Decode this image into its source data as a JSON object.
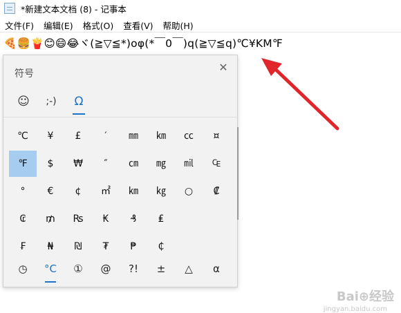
{
  "window": {
    "title": "*新建文本文档 (8) - 记事本"
  },
  "menu": [
    "文件(F)",
    "编辑(E)",
    "格式(O)",
    "查看(V)",
    "帮助(H)"
  ],
  "editor": {
    "text": "🍕🍔🍟😊😄😂ヾ(≧▽≦*)oφ(*￣0￣)q(≧▽≦q)℃¥KM℉"
  },
  "panel": {
    "title": "符号",
    "close": "✕",
    "categories": [
      {
        "icon": "☺",
        "name": "emoji"
      },
      {
        "icon": ";-)",
        "name": "kaomoji"
      },
      {
        "icon": "Ω",
        "name": "symbols",
        "active": true
      }
    ],
    "symbols": [
      [
        "℃",
        "¥",
        "£",
        "′",
        "㎜",
        "㎞",
        "㏄",
        "¤"
      ],
      [
        "℉",
        "$",
        "₩",
        "″",
        "㎝",
        "㎎",
        "㏕",
        "₠"
      ],
      [
        "°",
        "€",
        "¢",
        "㎡",
        "㎞",
        "㎏",
        "○",
        "₡"
      ],
      [
        "₢",
        "₥",
        "₨",
        "₭",
        "₰",
        "₤",
        "",
        ""
      ],
      [
        "₣",
        "₦",
        "₪",
        "₮",
        "₱",
        "₵",
        "",
        ""
      ]
    ],
    "selected": {
      "row": 1,
      "col": 0
    },
    "bottom_tabs": [
      {
        "icon": "◷",
        "name": "recent"
      },
      {
        "icon": "°C",
        "name": "units",
        "active": true
      },
      {
        "icon": "①",
        "name": "numbers"
      },
      {
        "icon": "@",
        "name": "punctuation"
      },
      {
        "icon": "?!",
        "name": "interrobang"
      },
      {
        "icon": "±",
        "name": "math"
      },
      {
        "icon": "△",
        "name": "shapes"
      },
      {
        "icon": "α",
        "name": "greek"
      }
    ]
  },
  "watermark": {
    "text": "Bai⊕经验",
    "url": "jingyan.baidu.com"
  },
  "colors": {
    "accent": "#1a73c7",
    "selected": "#a6cdf0",
    "arrow": "#e0262b"
  }
}
